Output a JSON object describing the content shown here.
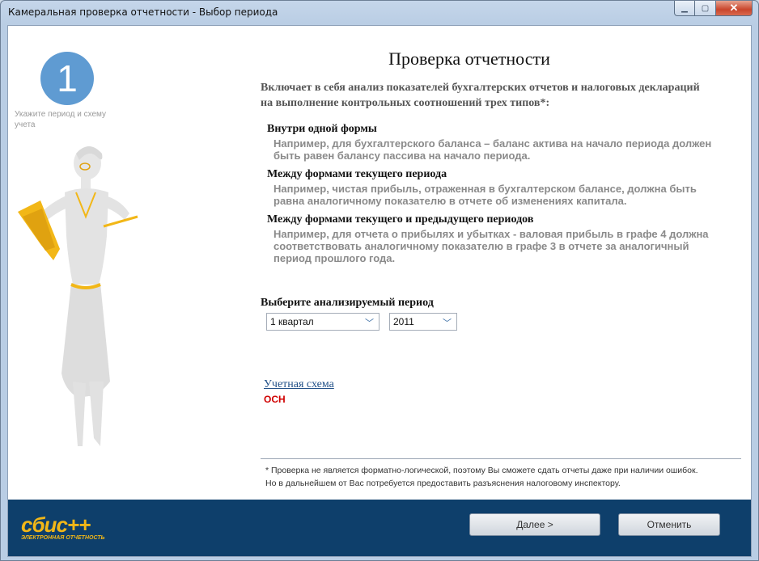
{
  "window": {
    "title": "Камеральная проверка отчетности - Выбор периода"
  },
  "step": {
    "number": "1",
    "hint": "Укажите период и схему учета"
  },
  "main": {
    "title": "Проверка отчетности",
    "intro": "Включает в себя анализ показателей бухгалтерских отчетов и налоговых деклараций на выполнение контрольных соотношений трех типов*:",
    "sections": [
      {
        "heading": "Внутри одной формы",
        "text": "Например, для бухгалтерского баланса – баланс актива на начало периода должен быть равен балансу пассива на начало периода."
      },
      {
        "heading": "Между формами текущего периода",
        "text": "Например, чистая прибыль, отраженная в бухгалтерском балансе, должна быть равна аналогичному показателю в отчете об изменениях капитала."
      },
      {
        "heading": "Между формами текущего и предыдущего периодов",
        "text": "Например, для отчета о прибылях и убытках  - валовая прибыль в графе 4 должна соответствовать аналогичному показателю в графе 3 в отчете за аналогичный период прошлого года."
      }
    ],
    "period_label": "Выберите анализируемый период",
    "quarter": "1 квартал",
    "year": "2011",
    "scheme_link": "Учетная схема",
    "scheme_value": "ОСН",
    "footnote_1": "* Проверка не является форматно-логической, поэтому Вы сможете сдать отчеты даже при наличии ошибок.",
    "footnote_2": "Но в дальнейшем от Вас потребуется предоставить разъяснения налоговому инспектору."
  },
  "footer": {
    "logo_text": "сбис++",
    "logo_sub": "ЭЛЕКТРОННАЯ ОТЧЕТНОСТЬ",
    "next_label": "Далее >",
    "cancel_label": "Отменить"
  },
  "colors": {
    "bar": "#0e3f6b",
    "accent": "#f2b717",
    "step": "#5f9bd2"
  }
}
